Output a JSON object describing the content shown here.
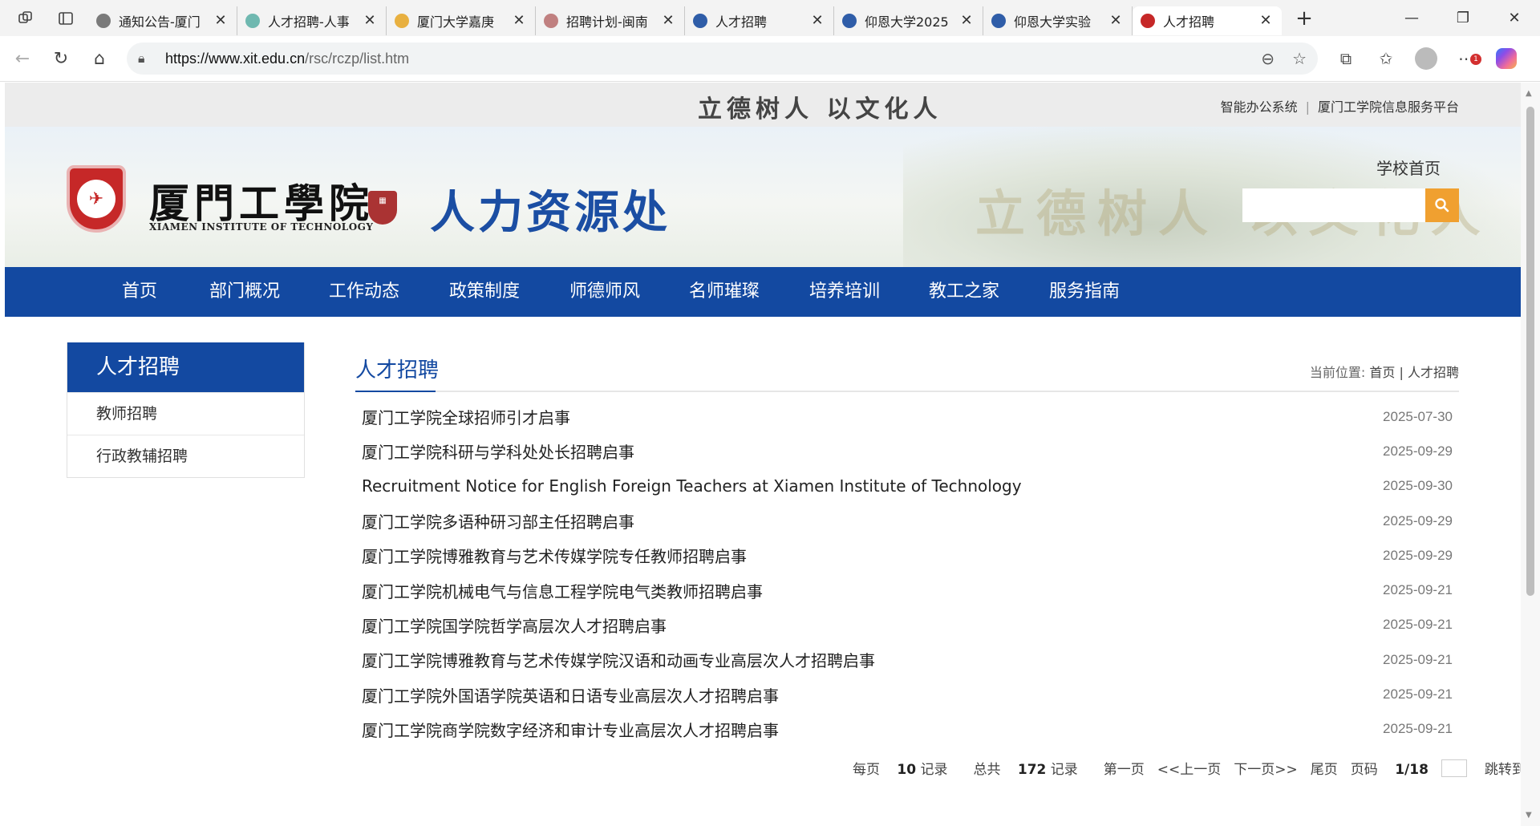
{
  "browser": {
    "tabs": [
      {
        "label": "通知公告-厦门",
        "fav_color": "#7a7a7a"
      },
      {
        "label": "人才招聘-人事",
        "fav_color": "#6fb8b0"
      },
      {
        "label": "厦门大学嘉庚",
        "fav_color": "#e8b040"
      },
      {
        "label": "招聘计划-闽南",
        "fav_color": "#c08080"
      },
      {
        "label": "人才招聘",
        "fav_color": "#2f5da8"
      },
      {
        "label": "仰恩大学2025",
        "fav_color": "#2f5da8"
      },
      {
        "label": "仰恩大学实验",
        "fav_color": "#2f5da8"
      },
      {
        "label": "人才招聘",
        "fav_color": "#c62828"
      }
    ],
    "url_host": "https://www.xit.edu.cn",
    "url_path": "/rsc/rczp/list.htm",
    "notification_count": "1"
  },
  "site": {
    "slogan": "立德树人  以文化人",
    "top_links": [
      "智能办公系统",
      "厦门工学院信息服务平台"
    ],
    "school_name": "厦門工學院",
    "school_name_en": "XIAMEN INSTITUTE OF TECHNOLOGY",
    "dept_title": "人力资源处",
    "home_link": "学校首页",
    "nav": [
      "首页",
      "部门概况",
      "工作动态",
      "政策制度",
      "师德师风",
      "名师璀璨",
      "培养培训",
      "教工之家",
      "服务指南"
    ]
  },
  "sidebar": {
    "heading": "人才招聘",
    "items": [
      {
        "label": "教师招聘"
      },
      {
        "label": "行政教辅招聘"
      }
    ]
  },
  "content": {
    "title": "人才招聘",
    "breadcrumb_prefix": "当前位置:",
    "breadcrumb_home": "首页",
    "breadcrumb_current": "人才招聘",
    "rows": [
      {
        "title": "厦门工学院全球招师引才启事",
        "date": "2025-07-30"
      },
      {
        "title": "厦门工学院科研与学科处处长招聘启事",
        "date": "2025-09-29"
      },
      {
        "title": "Recruitment Notice for English Foreign Teachers at Xiamen Institute of Technology",
        "date": "2025-09-30"
      },
      {
        "title": "厦门工学院多语种研习部主任招聘启事",
        "date": "2025-09-29"
      },
      {
        "title": "厦门工学院博雅教育与艺术传媒学院专任教师招聘启事",
        "date": "2025-09-29"
      },
      {
        "title": "厦门工学院机械电气与信息工程学院电气类教师招聘启事",
        "date": "2025-09-21"
      },
      {
        "title": "厦门工学院国学院哲学高层次人才招聘启事",
        "date": "2025-09-21"
      },
      {
        "title": "厦门工学院博雅教育与艺术传媒学院汉语和动画专业高层次人才招聘启事",
        "date": "2025-09-21"
      },
      {
        "title": "厦门工学院外国语学院英语和日语专业高层次人才招聘启事",
        "date": "2025-09-21"
      },
      {
        "title": "厦门工学院商学院数字经济和审计专业高层次人才招聘启事",
        "date": "2025-09-21"
      }
    ]
  },
  "pager": {
    "per_page_prefix": "每页",
    "per_page": "10",
    "per_page_suffix": "记录",
    "total_prefix": "总共",
    "total": "172",
    "total_suffix": "记录",
    "first": "第一页",
    "prev": "<<上一页",
    "next": "下一页>>",
    "last": "尾页",
    "page_prefix": "页码",
    "page": "1/18",
    "jump": "跳转到"
  }
}
